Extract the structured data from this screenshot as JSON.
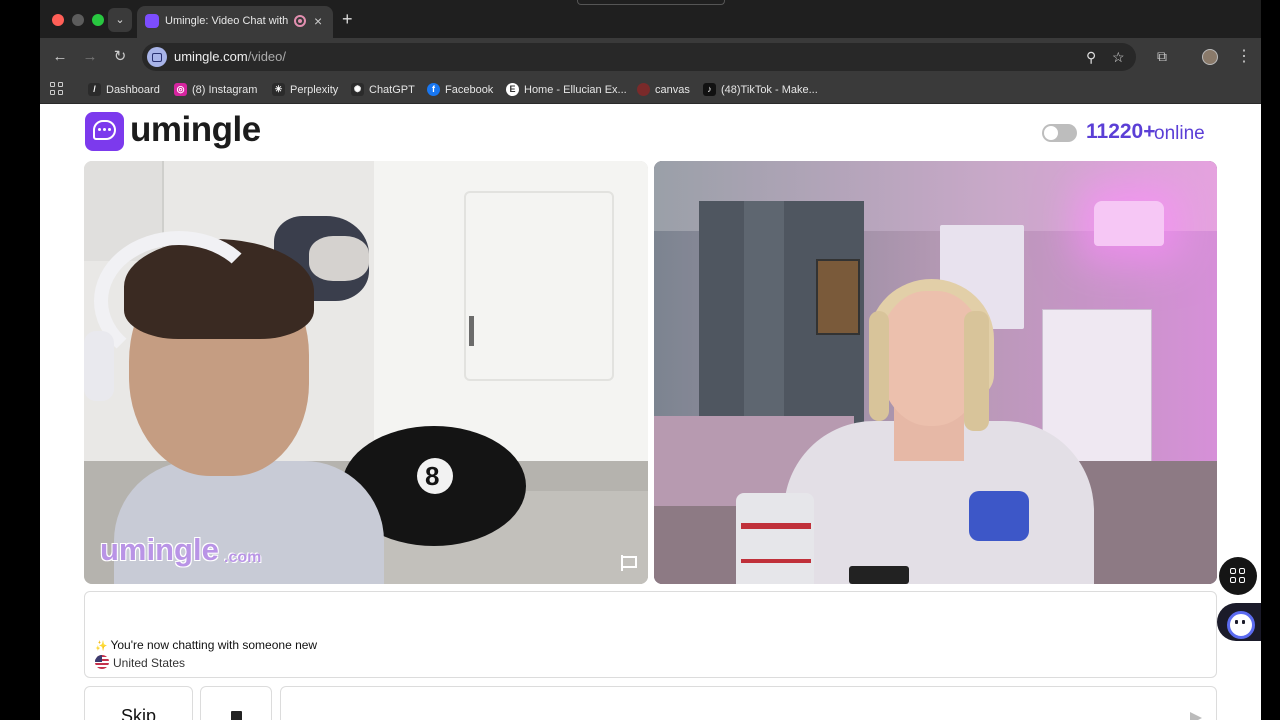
{
  "browser": {
    "tab_title": "Umingle: Video Chat with",
    "tab_close": "×",
    "new_tab": "+",
    "tab_search": "⌄",
    "url_domain": "umingle.com",
    "url_path": "/video/",
    "nav": {
      "back": "←",
      "forward": "→",
      "reload": "↻"
    },
    "omnibox_icons": {
      "zoom": "⚲",
      "bookmark_star": "☆"
    },
    "extensions": "⧉",
    "menu": "⋮",
    "bookmarks": [
      {
        "label": "Dashboard",
        "icon": "dashboard-icon",
        "icon_text": "/",
        "color": "#2b2b2b"
      },
      {
        "label": "(8) Instagram",
        "icon": "instagram-icon",
        "icon_text": "◎",
        "color": "#d6249f"
      },
      {
        "label": "Perplexity",
        "icon": "perplexity-icon",
        "icon_text": "✳",
        "color": "#2b2b2b"
      },
      {
        "label": "ChatGPT",
        "icon": "chatgpt-icon",
        "icon_text": "✺",
        "color": "#2b2b2b"
      },
      {
        "label": "Facebook",
        "icon": "facebook-icon",
        "icon_text": "f",
        "color": "#1877f2"
      },
      {
        "label": "Home - Ellucian Ex...",
        "icon": "ellucian-icon",
        "icon_text": "E",
        "color": "#ffffff"
      },
      {
        "label": "canvas",
        "icon": "canvas-icon",
        "icon_text": "",
        "color": "#7a2a2a"
      },
      {
        "label": "(48)TikTok - Make...",
        "icon": "tiktok-icon",
        "icon_text": "♪",
        "color": "#111111"
      }
    ]
  },
  "header": {
    "logo_text": "umingle",
    "online_count": "11220+",
    "online_label": "online",
    "accent_color": "#5b3fd6"
  },
  "video": {
    "watermark": "umingle",
    "watermark_domain": ".com"
  },
  "chat": {
    "status_message": "You're now chatting with someone new",
    "status_icon": "✨",
    "country": "United States"
  },
  "controls": {
    "skip_label": "Skip",
    "message_placeholder": ""
  }
}
